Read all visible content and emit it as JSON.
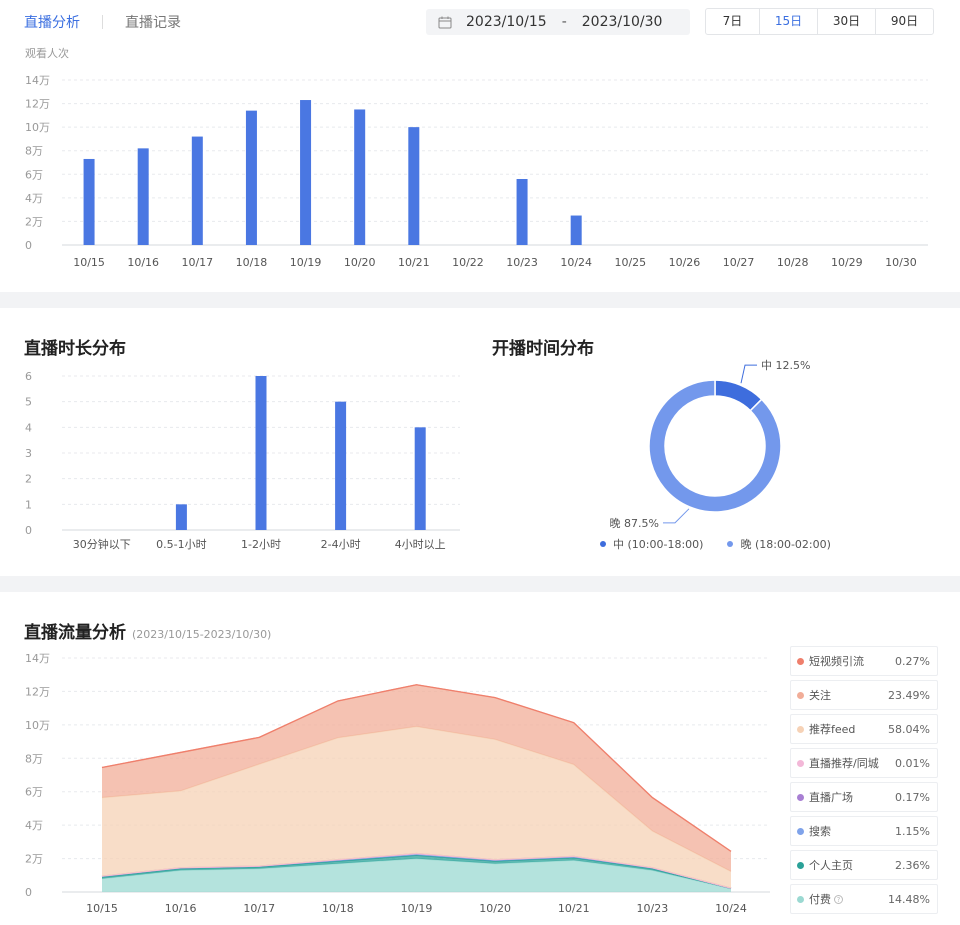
{
  "tabs": [
    {
      "label": "直播分析",
      "active": true
    },
    {
      "label": "直播记录",
      "active": false
    }
  ],
  "date_range": {
    "start": "2023/10/15",
    "separator": "-",
    "end": "2023/10/30"
  },
  "periods": [
    {
      "label": "7日",
      "active": false
    },
    {
      "label": "15日",
      "active": true
    },
    {
      "label": "30日",
      "active": false
    },
    {
      "label": "90日",
      "active": false
    }
  ],
  "colors": {
    "accent": "#3b6fe0",
    "bar": "#4a77e2",
    "pie_mid": "#3e6ddd",
    "pie_eve": "#7398ec"
  },
  "chart_data": [
    {
      "type": "bar",
      "ylabel": "观看人次",
      "categories": [
        "10/15",
        "10/16",
        "10/17",
        "10/18",
        "10/19",
        "10/20",
        "10/21",
        "10/22",
        "10/23",
        "10/24",
        "10/25",
        "10/26",
        "10/27",
        "10/28",
        "10/29",
        "10/30"
      ],
      "values": [
        73000,
        82000,
        92000,
        114000,
        123000,
        115000,
        100000,
        0,
        56000,
        25000,
        0,
        0,
        0,
        0,
        0,
        0
      ],
      "ylim": [
        0,
        140000
      ],
      "yticks": [
        0,
        20000,
        40000,
        60000,
        80000,
        100000,
        120000,
        140000
      ],
      "yticklabels": [
        "0",
        "2万",
        "4万",
        "6万",
        "8万",
        "10万",
        "12万",
        "14万"
      ]
    },
    {
      "type": "bar",
      "title": "直播时长分布",
      "categories": [
        "30分钟以下",
        "0.5-1小时",
        "1-2小时",
        "2-4小时",
        "4小时以上"
      ],
      "values": [
        0,
        1,
        6,
        5,
        4
      ],
      "ylim": [
        0,
        6
      ],
      "yticks": [
        0,
        1,
        2,
        3,
        4,
        5,
        6
      ],
      "yticklabels": [
        "0",
        "1",
        "2",
        "3",
        "4",
        "5",
        "6"
      ]
    },
    {
      "type": "pie",
      "title": "开播时间分布",
      "slices": [
        {
          "label": "中",
          "value": 12.5,
          "value_text": "12.5%",
          "legend": "中 (10:00-18:00)",
          "color": "#3e6ddd"
        },
        {
          "label": "晚",
          "value": 87.5,
          "value_text": "87.5%",
          "legend": "晚 (18:00-02:00)",
          "color": "#7398ec"
        }
      ]
    },
    {
      "type": "area",
      "title": "直播流量分析",
      "subtitle": "(2023/10/15-2023/10/30)",
      "categories": [
        "10/15",
        "10/16",
        "10/17",
        "10/18",
        "10/19",
        "10/20",
        "10/21",
        "10/23",
        "10/24"
      ],
      "ylim": [
        0,
        140000
      ],
      "yticks": [
        0,
        20000,
        40000,
        60000,
        80000,
        100000,
        120000,
        140000
      ],
      "yticklabels": [
        "0",
        "2万",
        "4万",
        "6万",
        "8万",
        "10万",
        "12万",
        "14万"
      ],
      "series": [
        {
          "name": "付费",
          "pct": "14.48%",
          "color": "#9bd9d2",
          "values": [
            8000,
            13000,
            14000,
            17000,
            20000,
            17000,
            19000,
            13000,
            2000
          ]
        },
        {
          "name": "个人主页",
          "pct": "2.36%",
          "color": "#2aa198",
          "values": [
            1000,
            1000,
            1000,
            1500,
            2000,
            1500,
            1500,
            1000,
            200
          ]
        },
        {
          "name": "搜索",
          "pct": "1.15%",
          "color": "#7fa3ea",
          "values": [
            500,
            500,
            500,
            800,
            1000,
            800,
            800,
            500,
            100
          ]
        },
        {
          "name": "直播广场",
          "pct": "0.17%",
          "color": "#a87fd3",
          "values": [
            0,
            0,
            0,
            0,
            0,
            0,
            0,
            0,
            0
          ]
        },
        {
          "name": "直播推荐/同城",
          "pct": "0.01%",
          "color": "#f3b8d8",
          "values": [
            0,
            0,
            0,
            0,
            0,
            0,
            0,
            0,
            0
          ]
        },
        {
          "name": "推荐feed",
          "pct": "58.04%",
          "color": "#f6d2b6",
          "values": [
            47000,
            46000,
            61000,
            73000,
            76000,
            72000,
            55000,
            22000,
            10000
          ]
        },
        {
          "name": "关注",
          "pct": "23.49%",
          "color": "#f1ad98",
          "values": [
            18000,
            23000,
            16000,
            22000,
            25000,
            25000,
            25000,
            20000,
            12000
          ]
        },
        {
          "name": "短视频引流",
          "pct": "0.27%",
          "color": "#ef7f6c",
          "values": [
            0,
            0,
            0,
            0,
            0,
            0,
            0,
            0,
            0
          ]
        }
      ]
    }
  ]
}
